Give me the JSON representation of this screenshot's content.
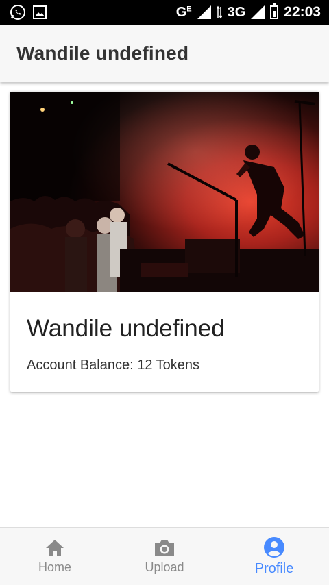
{
  "status_bar": {
    "network_label": "G",
    "network_sup": "E",
    "network_label_2": "3G",
    "time": "22:03",
    "icons": [
      "whatsapp-icon",
      "gallery-icon",
      "signal-icon",
      "data-arrows-icon",
      "battery-icon"
    ]
  },
  "header": {
    "title": "Wandile undefined"
  },
  "card": {
    "image_subject": "concert-stage-photo",
    "title": "Wandile undefined",
    "balance_text": "Account Balance: 12 Tokens"
  },
  "tabs": [
    {
      "label": "Home",
      "icon": "home-icon",
      "active": false
    },
    {
      "label": "Upload",
      "icon": "camera-icon",
      "active": false
    },
    {
      "label": "Profile",
      "icon": "person-circle-icon",
      "active": true
    }
  ],
  "colors": {
    "accent": "#488aff",
    "inactive": "#8a8a8a",
    "header_bg": "#f7f7f7"
  }
}
